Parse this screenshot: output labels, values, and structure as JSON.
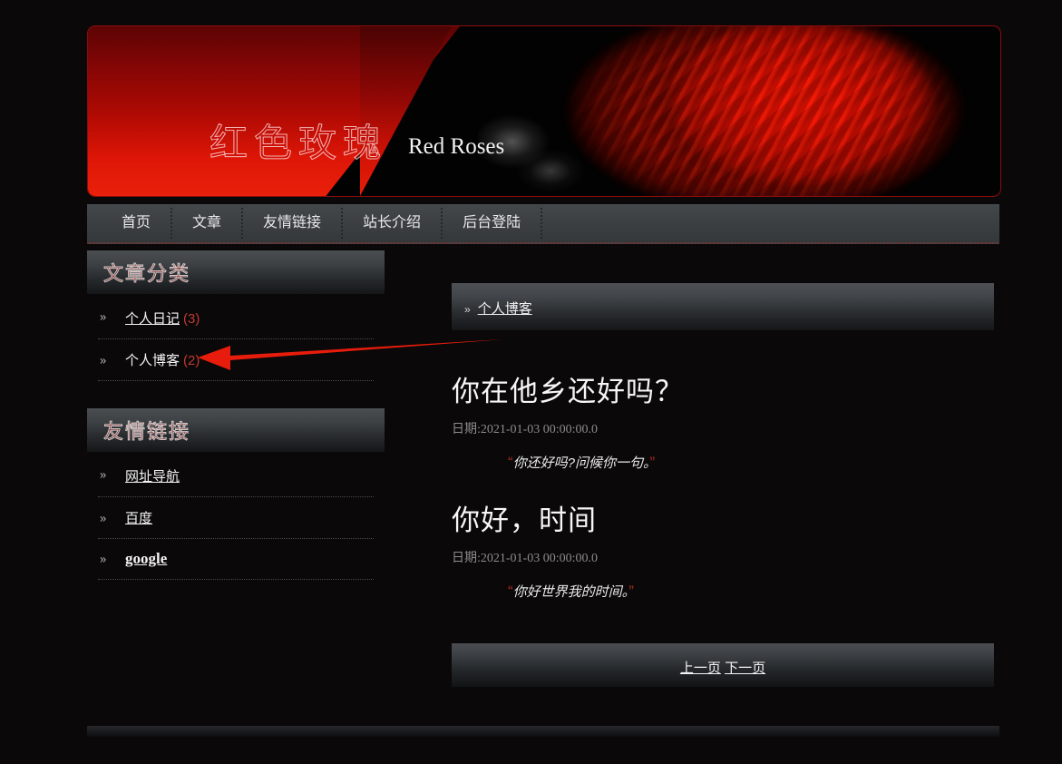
{
  "banner": {
    "brand_cn": "红色玫瑰",
    "brand_en": "Red Roses",
    "accent_color": "#c10d08",
    "border_color": "#8d0d0d"
  },
  "nav": {
    "items": [
      {
        "label": "首页"
      },
      {
        "label": "文章"
      },
      {
        "label": "友情链接"
      },
      {
        "label": "站长介绍"
      },
      {
        "label": "后台登陆"
      }
    ]
  },
  "sidebar": {
    "panels": [
      {
        "title": "文章分类",
        "rows": [
          {
            "label": "个人日记",
            "count": "(3)",
            "underline": true
          },
          {
            "label": "个人博客",
            "count": "(2)",
            "underline": false
          }
        ]
      },
      {
        "title": "友情链接",
        "rows": [
          {
            "label": "网址导航",
            "count": "",
            "underline": true
          },
          {
            "label": "百度",
            "count": "",
            "underline": true
          },
          {
            "label": "google",
            "count": "",
            "underline": true,
            "latin": true
          }
        ]
      }
    ]
  },
  "main": {
    "breadcrumb": {
      "bullet": "»",
      "link": "个人博客"
    },
    "articles": [
      {
        "title": "你在他乡还好吗？",
        "date": "日期:2021-01-03 00:00:00.0",
        "quote_open": "“",
        "excerpt": "你还好吗?问候你一句。",
        "quote_close": "”"
      },
      {
        "title": "你好，时间",
        "date": "日期:2021-01-03 00:00:00.0",
        "quote_open": "“",
        "excerpt": "你好世界我的时间。",
        "quote_close": "”"
      }
    ],
    "pager": {
      "prev": "上一页",
      "next": "下一页"
    }
  },
  "annotation": {
    "arrow_color": "#e81c0c",
    "target": "个人博客 (2)"
  },
  "bullets": {
    "marker": "»"
  }
}
